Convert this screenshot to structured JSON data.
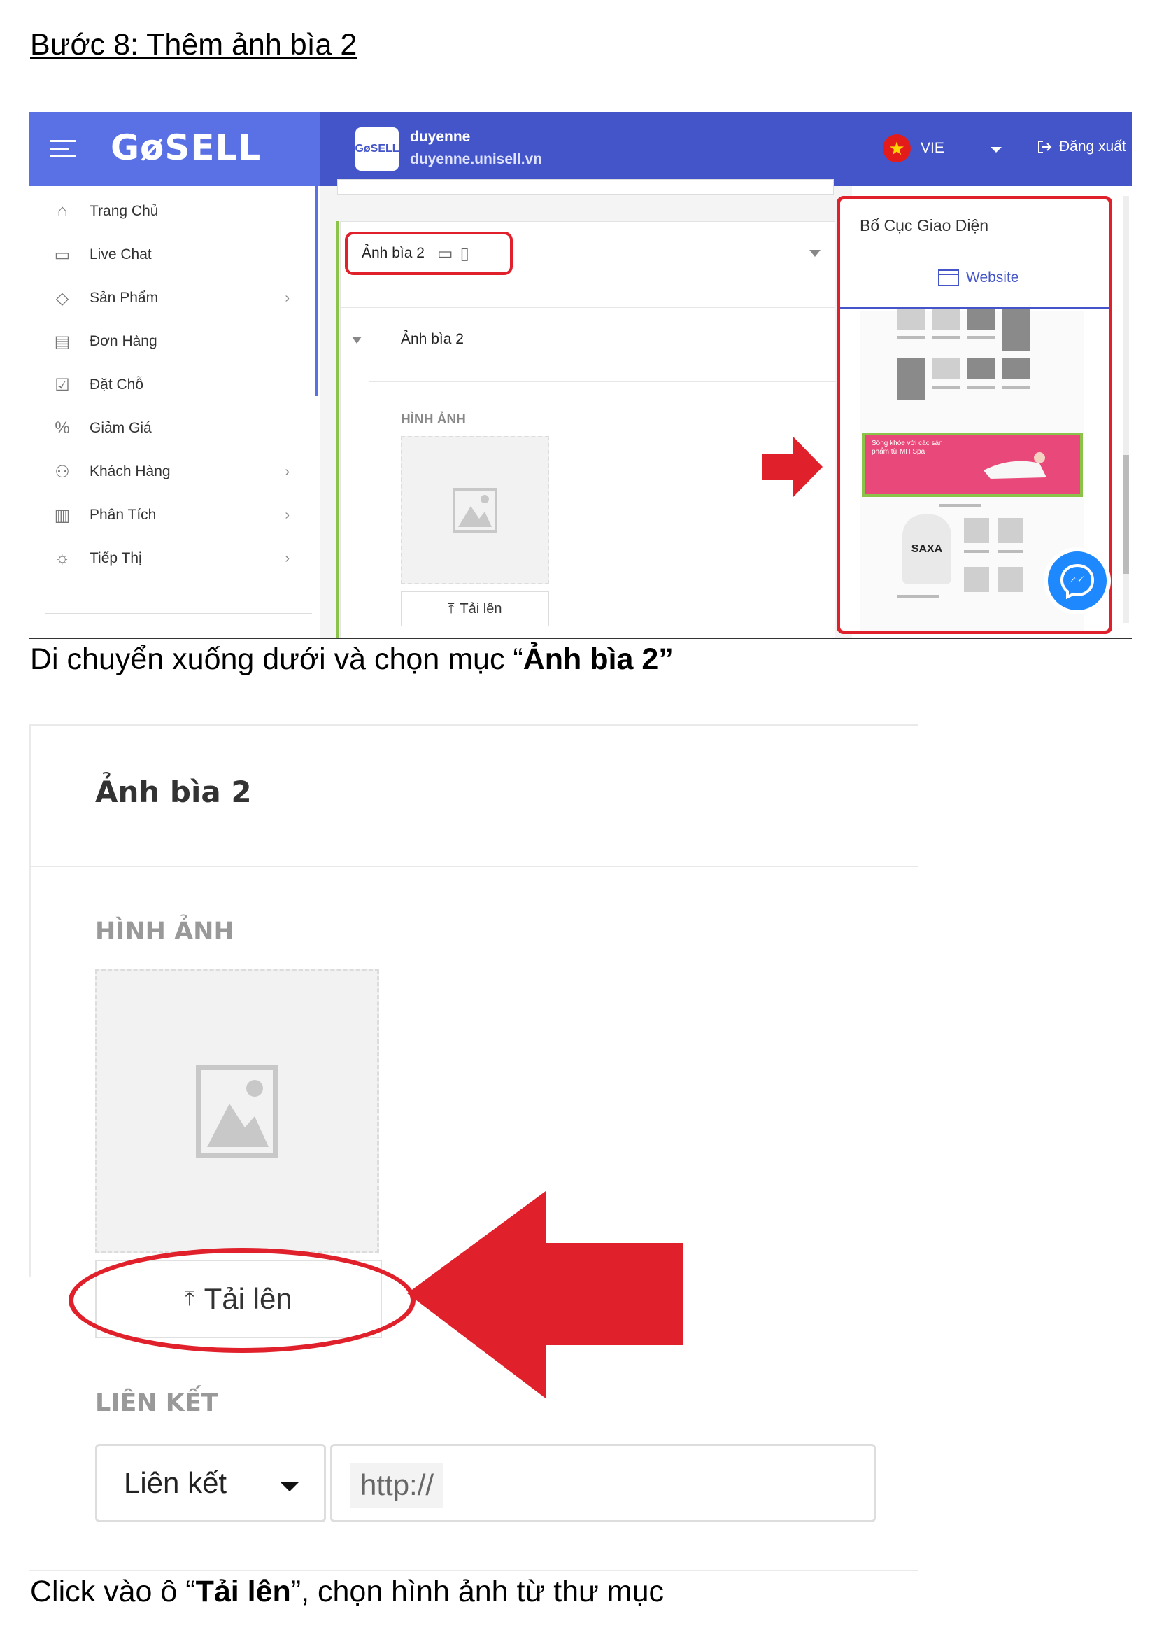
{
  "heading": "Bước 8: Thêm ảnh bìa 2 ",
  "caption1": {
    "before": "Di chuyển xuống dưới và chọn mục “",
    "bold": "Ảnh bìa 2",
    "after": "”"
  },
  "caption2": {
    "before": "Click vào ô “",
    "bold": "Tải lên",
    "after": "”, chọn hình ảnh từ thư mục"
  },
  "app": {
    "logo": "GøSELL",
    "store_logo": "GøSELL",
    "store_name": "duyenne",
    "store_url": "duyenne.unisell.vn",
    "language": "VIE",
    "logout": "Đăng xuất",
    "colors": {
      "sidebar_header": "#5a71e6",
      "topbar": "#4355c9",
      "highlight": "#e0202a",
      "selected": "#8bc34a"
    }
  },
  "sidebar": {
    "items": [
      {
        "label": "Trang Chủ",
        "icon": "home-icon",
        "has_submenu": false
      },
      {
        "label": "Live Chat",
        "icon": "chat-icon",
        "has_submenu": false
      },
      {
        "label": "Sản Phẩm",
        "icon": "tag-icon",
        "has_submenu": true
      },
      {
        "label": "Đơn Hàng",
        "icon": "receipt-icon",
        "has_submenu": false
      },
      {
        "label": "Đặt Chỗ",
        "icon": "calendar-icon",
        "has_submenu": false
      },
      {
        "label": "Giảm Giá",
        "icon": "discount-icon",
        "has_submenu": false
      },
      {
        "label": "Khách Hàng",
        "icon": "customers-icon",
        "has_submenu": true
      },
      {
        "label": "Phân Tích",
        "icon": "analytics-icon",
        "has_submenu": true
      },
      {
        "label": "Tiếp Thị",
        "icon": "lightbulb-icon",
        "has_submenu": true
      }
    ]
  },
  "editor": {
    "section_tab": "Ảnh bìa 2",
    "sub_title": "Ảnh bìa 2",
    "image_label": "HÌNH ẢNH",
    "upload_label": "Tải lên"
  },
  "layout_panel": {
    "title": "Bố Cục Giao Diện",
    "tab": "Website",
    "banner_text": "Sống khỏe với các sản phẩm từ MH Spa",
    "product_brand": "SAXA"
  },
  "zoom": {
    "title": "Ảnh bìa 2",
    "image_label": "HÌNH ẢNH",
    "upload_label": "Tải lên",
    "link_label": "LIÊN KẾT",
    "link_type": "Liên kết",
    "url_placeholder": "http://"
  }
}
